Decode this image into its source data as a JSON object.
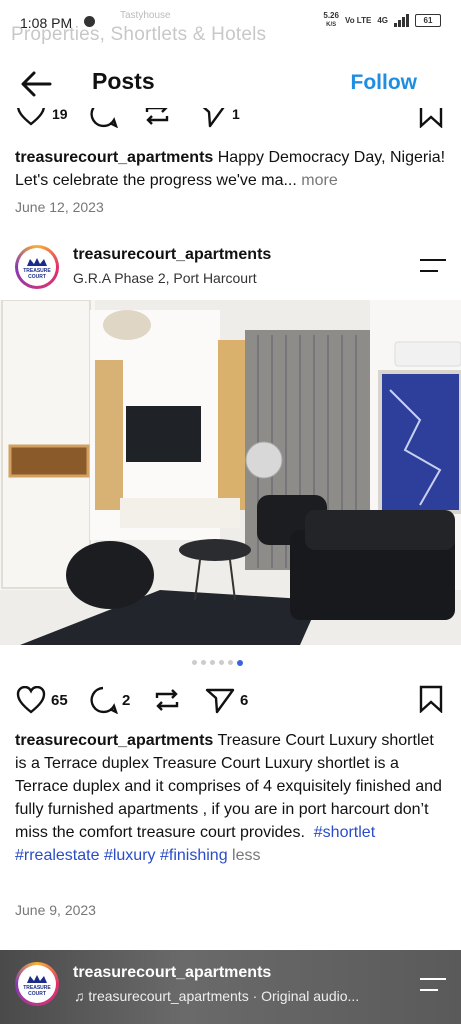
{
  "status": {
    "time": "1:08 PM",
    "app_name": "Tastyhouse",
    "overlay_text": "Properties, Shortlets & Hotels",
    "speed": "5.26",
    "speed_unit": "K/S",
    "network": "Vo LTE",
    "signal": "4G",
    "battery": "61"
  },
  "header": {
    "title": "Posts",
    "follow_label": "Follow"
  },
  "prev_post": {
    "username": "treasurecourt_apartments",
    "caption": "Happy Democracy Day, Nigeria! Let's celebrate the progress we've ma...",
    "more": "more",
    "date": "June 12, 2023",
    "like_count": "19",
    "share_count": "1"
  },
  "post": {
    "username": "treasurecourt_apartments",
    "location": "G.R.A Phase 2, Port Harcourt",
    "avatar_text": "TREASURE COURT",
    "likes": "65",
    "comments": "2",
    "shares": "6",
    "carousel_total": 6,
    "carousel_active": 5,
    "caption": "Treasure Court Luxury shortlet is a Terrace duplex Treasure Court Luxury shortlet is a Terrace duplex and it comprises of 4 exquisitely finished and fully furnished apartments , if you are in port harcourt don’t miss the comfort treasure court provides.",
    "hashtags": [
      "#shortlet",
      "#rrealestate",
      "#luxury",
      "#finishing"
    ],
    "less": "less",
    "date": "June 9, 2023"
  },
  "next_post": {
    "username": "treasurecourt_apartments",
    "audio": "treasurecourt_apartments · Original audio..."
  },
  "colors": {
    "accent": "#1f8ee0",
    "hashtag": "#2b4cc7",
    "dot_active": "#3b63e0"
  }
}
